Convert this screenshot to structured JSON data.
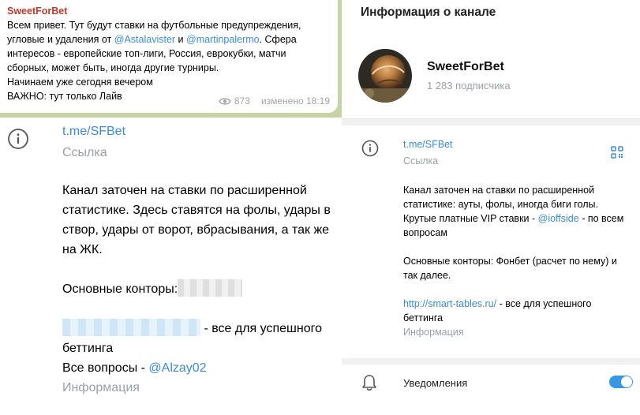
{
  "chat": {
    "sender": "SweetForBet",
    "message": {
      "part1": "Всем привет. Тут будут ставки на футбольные предупреждения, угловые и удаления от ",
      "mention1": "@Astalavister",
      "and": " и ",
      "mention2": "@martinpalermo",
      "part2": ". Сфера интересов - европейские топ-лиги, Россия, еврокубки, матчи сборных, может быть, иногда другие турниры.",
      "line2": "Начинаем уже сегодня вечером",
      "line3": "ВАЖНО: тут только Лайв"
    },
    "views": "873",
    "edited_time": "изменено 18:19"
  },
  "left_info": {
    "link": "t.me/SFBet",
    "link_caption": "Ссылка",
    "desc": "Канал заточен на ставки по расширенной статистике. Здесь ставятся на фолы, удары в створ, удары от ворот, вбрасывания, а так же на ЖК.",
    "offices_label": "Основные конторы:",
    "betting_suffix": " - все для успешного беттинга",
    "questions_label": "Все вопросы - ",
    "questions_mention": "@Alzay02",
    "info_caption": "Информация"
  },
  "right_panel": {
    "title": "Информация о канале",
    "channel_name": "SweetForBet",
    "subscribers": "1 283 подписчика",
    "link": "t.me/SFBet",
    "link_caption": "Ссылка",
    "desc_part1": "Канал заточен на ставки по расширенной статистике: ауты, фолы, иногда биги голы. Крутые платные VIP ставки - ",
    "desc_mention": "@ioffside",
    "desc_part2": " - по всем вопросам",
    "offices": "Основные конторы: Фонбет (расчет по нему) и так далее.",
    "site_link": "http://smart-tables.ru/",
    "site_suffix": " - все для успешного беттинга",
    "info_caption": "Информация",
    "notifications_label": "Уведомления",
    "notifications_on": true
  },
  "colors": {
    "link": "#3a8dd8",
    "sender": "#c0392b",
    "chat_background": "#c7d3a4",
    "toggle_on": "#3a97e6"
  }
}
